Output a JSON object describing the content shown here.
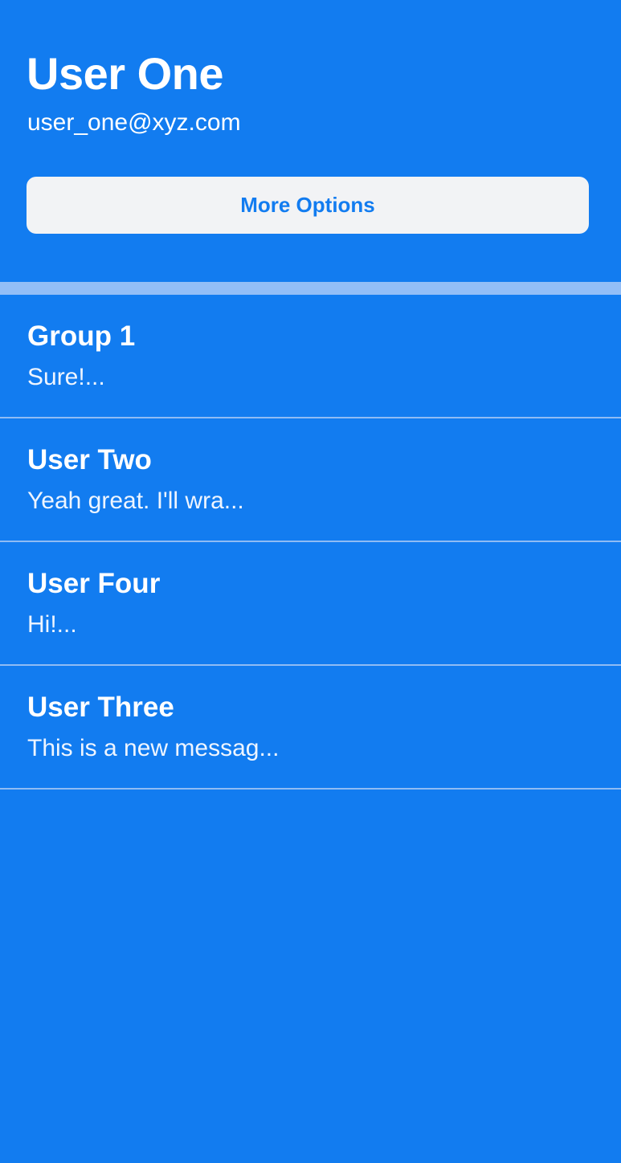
{
  "profile": {
    "name": "User One",
    "email": "user_one@xyz.com",
    "more_options_label": "More Options"
  },
  "conversations": [
    {
      "title": "Group 1",
      "preview": "Sure!..."
    },
    {
      "title": "User Two",
      "preview": "Yeah great. I'll wra..."
    },
    {
      "title": "User Four",
      "preview": "Hi!..."
    },
    {
      "title": "User Three",
      "preview": "This is a new messag..."
    }
  ],
  "colors": {
    "background": "#127cf0",
    "button_background": "#f2f3f5",
    "button_text": "#127cf0",
    "divider": "#93bef7",
    "row_separator": "#8fbcf4",
    "text": "#ffffff"
  }
}
